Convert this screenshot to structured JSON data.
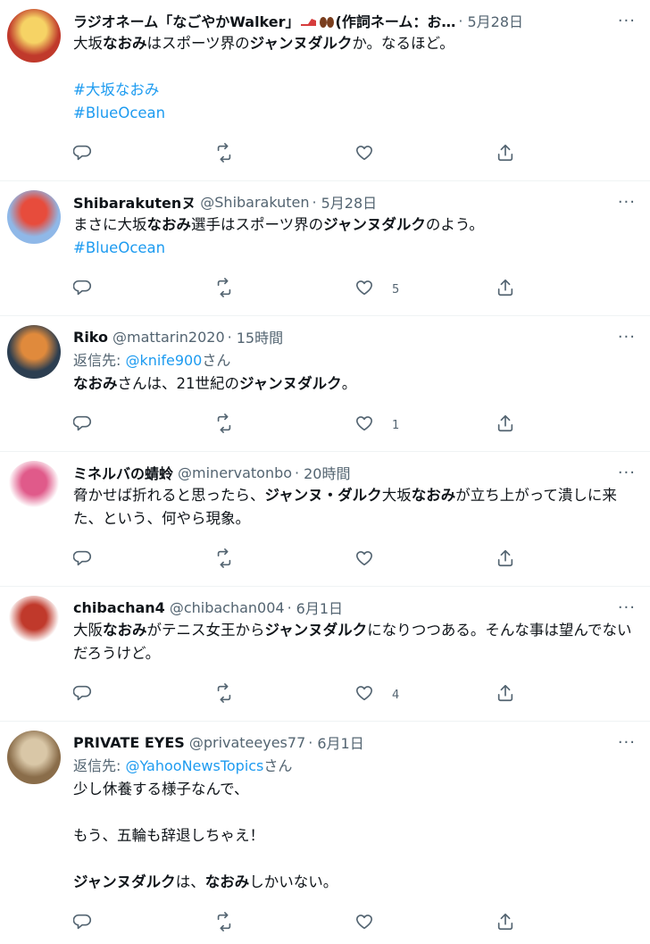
{
  "tweets": [
    {
      "name": "ラジオネーム「なごやかWalker」",
      "name_tail": "(作詞ネーム：お…",
      "handle": "",
      "time": "5月28日",
      "reply_to_label": "",
      "reply_to_handle": "",
      "reply_to_suffix": "",
      "paragraphs": [
        [
          {
            "t": "大坂",
            "b": false
          },
          {
            "t": "なおみ",
            "b": true
          },
          {
            "t": "はスポーツ界の",
            "b": false
          },
          {
            "t": "ジャンヌダルク",
            "b": true
          },
          {
            "t": "か。なるほど。",
            "b": false
          }
        ],
        [],
        [
          {
            "t": "#大坂なおみ",
            "tag": true
          }
        ],
        [
          {
            "t": "#BlueOcean",
            "tag": true
          }
        ]
      ],
      "reply_count": "",
      "retweet_count": "",
      "like_count": "",
      "avatar_colors": [
        "#c0392b",
        "#f6d365"
      ]
    },
    {
      "name": "Shibarakutenヌ",
      "handle": "@Shibarakuten",
      "time": "5月28日",
      "paragraphs": [
        [
          {
            "t": "まさに大坂",
            "b": false
          },
          {
            "t": "なおみ",
            "b": true
          },
          {
            "t": "選手はスポーツ界の",
            "b": false
          },
          {
            "t": "ジャンヌダルク",
            "b": true
          },
          {
            "t": "のよう。",
            "b": false
          }
        ],
        [
          {
            "t": "#BlueOcean",
            "tag": true
          }
        ]
      ],
      "like_count": "5",
      "avatar_colors": [
        "#8fb8e8",
        "#e74c3c"
      ]
    },
    {
      "name": "Riko",
      "handle": "@mattarin2020",
      "time": "15時間",
      "reply_to_label": "返信先: ",
      "reply_to_handle": "@knife900",
      "reply_to_suffix": "さん",
      "paragraphs": [
        [
          {
            "t": "なおみ",
            "b": true
          },
          {
            "t": "さんは、21世紀の",
            "b": false
          },
          {
            "t": "ジャンヌダルク",
            "b": true
          },
          {
            "t": "。",
            "b": false
          }
        ]
      ],
      "like_count": "1",
      "avatar_colors": [
        "#2c3e50",
        "#e08a3c"
      ]
    },
    {
      "name": "ミネルバの蜻蛉",
      "handle": "@minervatonbo",
      "time": "20時間",
      "paragraphs": [
        [
          {
            "t": "脅かせば折れると思ったら、",
            "b": false
          },
          {
            "t": "ジャンヌ・ダルク",
            "b": true
          },
          {
            "t": "大坂",
            "b": false
          },
          {
            "t": "なおみ",
            "b": true
          },
          {
            "t": "が立ち上がって潰しに来た、という、何やら現象。",
            "b": false
          }
        ]
      ],
      "like_count": "",
      "avatar_colors": [
        "#ffffff",
        "#e05a8a"
      ]
    },
    {
      "name": "chibachan4",
      "handle": "@chibachan004",
      "time": "6月1日",
      "paragraphs": [
        [
          {
            "t": "大阪",
            "b": false
          },
          {
            "t": "なおみ",
            "b": true
          },
          {
            "t": "がテニス女王から",
            "b": false
          },
          {
            "t": "ジャンヌダルク",
            "b": true
          },
          {
            "t": "になりつつある。そんな事は望んでないだろうけど。",
            "b": false
          }
        ]
      ],
      "like_count": "4",
      "avatar_colors": [
        "#ffffff",
        "#c0392b"
      ]
    },
    {
      "name": "PRIVATE EYES",
      "handle": "@privateeyes77",
      "time": "6月1日",
      "reply_to_label": "返信先: ",
      "reply_to_handle": "@YahooNewsTopics",
      "reply_to_suffix": "さん",
      "paragraphs": [
        [
          {
            "t": "少し休養する様子なんで、",
            "b": false
          }
        ],
        [],
        [
          {
            "t": "もう、五輪も辞退しちゃえ！",
            "b": false
          }
        ],
        [],
        [
          {
            "t": "ジャンヌダルク",
            "b": true
          },
          {
            "t": "は、",
            "b": false
          },
          {
            "t": "なおみ",
            "b": true
          },
          {
            "t": "しかいない。",
            "b": false
          }
        ]
      ],
      "like_count": "",
      "avatar_colors": [
        "#8a6d4a",
        "#d9c7a7"
      ]
    }
  ],
  "dot_separator": "·",
  "more_label": "···",
  "icons": {
    "reply": "reply-icon",
    "retweet": "retweet-icon",
    "like": "heart-icon",
    "share": "share-icon"
  }
}
